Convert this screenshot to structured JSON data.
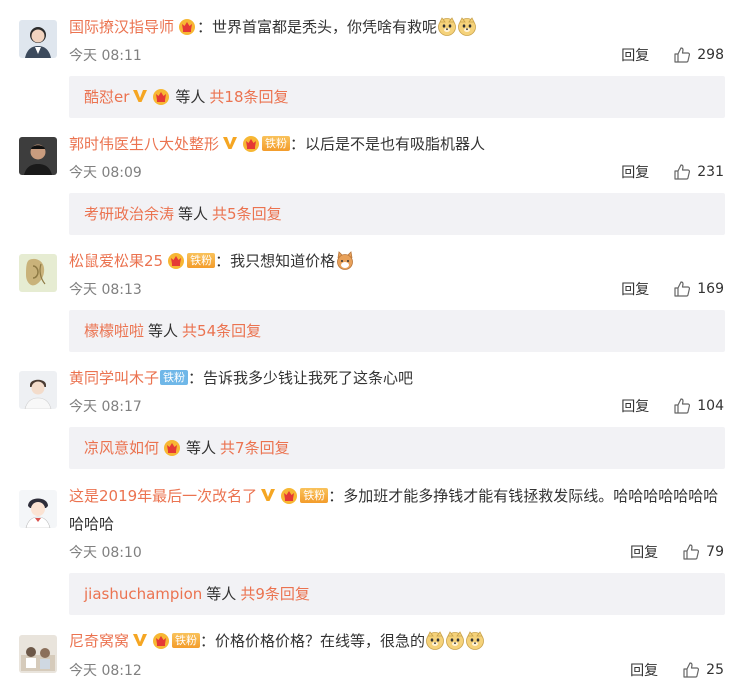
{
  "comments": [
    {
      "name": "国际撩汉指导师",
      "badges": [
        "crown"
      ],
      "sep": "：",
      "text": "世界首富都是秃头，你凭啥有救呢",
      "emojis": [
        "doge",
        "doge"
      ],
      "time": "今天 08:11",
      "reply": "回复",
      "likes": "298",
      "replies": {
        "name": "酷怼er",
        "badges": [
          "v",
          "crown"
        ],
        "mid": "等人",
        "total": "共18条回复"
      }
    },
    {
      "name": "郭时伟医生八大处整形",
      "badges": [
        "v",
        "crown",
        "tiefen"
      ],
      "sep": "：",
      "text": "以后是不是也有吸脂机器人",
      "emojis": [],
      "time": "今天 08:09",
      "reply": "回复",
      "likes": "231",
      "replies": {
        "name": "考研政治余涛",
        "badges": [],
        "mid": "等人",
        "total": "共5条回复"
      }
    },
    {
      "name": "松鼠爱松果25",
      "badges": [
        "crown",
        "tiefen"
      ],
      "sep": "：",
      "text": "我只想知道价格",
      "emojis": [
        "cat"
      ],
      "time": "今天 08:13",
      "reply": "回复",
      "likes": "169",
      "replies": {
        "name": "檬檬啦啦",
        "badges": [],
        "mid": "等人",
        "total": "共54条回复"
      }
    },
    {
      "name": "黄同学叫木子",
      "badges": [
        "tiefen-blue"
      ],
      "sep": "：",
      "text": "告诉我多少钱让我死了这条心吧",
      "emojis": [],
      "time": "今天 08:17",
      "reply": "回复",
      "likes": "104",
      "replies": {
        "name": "凉风意如何",
        "badges": [
          "crown"
        ],
        "mid": "等人",
        "total": "共7条回复"
      }
    },
    {
      "name": "这是2019年最后一次改名了",
      "badges": [
        "v",
        "crown",
        "tiefen"
      ],
      "sep": "：",
      "text": "多加班才能多挣钱才能有钱拯救发际线。哈哈哈哈哈哈哈哈哈哈",
      "emojis": [],
      "time": "今天 08:10",
      "reply": "回复",
      "likes": "79",
      "replies": {
        "name": "jiashuchampion",
        "badges": [],
        "mid": "等人",
        "total": "共9条回复"
      }
    },
    {
      "name": "尼奇窝窝",
      "badges": [
        "v",
        "crown",
        "tiefen"
      ],
      "sep": "：",
      "text": "价格价格价格？在线等，很急的",
      "emojis": [
        "doge",
        "doge",
        "doge"
      ],
      "time": "今天 08:12",
      "reply": "回复",
      "likes": "25",
      "replies": null
    }
  ],
  "tiefen_label": "铁粉",
  "colors": {
    "name": "#eb7350",
    "reply_bg": "#f2f2f5",
    "time": "#808080",
    "v": "#f5a623"
  }
}
